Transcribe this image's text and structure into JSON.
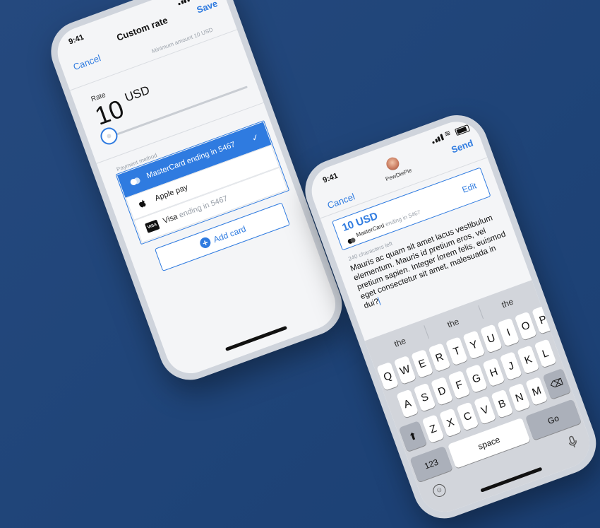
{
  "phone1": {
    "status": {
      "time": "9:41"
    },
    "nav": {
      "cancel": "Cancel",
      "title": "Custom rate",
      "save": "Save"
    },
    "hint": "Minimum amount 10 USD",
    "rate_label": "Rate",
    "amount": "10",
    "currency": "USD",
    "payment_section_label": "Payment method",
    "payment_methods": [
      {
        "label": "MasterCard ending in 5467",
        "selected": true,
        "icon": "mastercard-icon"
      },
      {
        "label": "Apple pay",
        "selected": false,
        "icon": "apple-icon"
      },
      {
        "label": "Visa",
        "suffix": "ending in 5467",
        "selected": false,
        "icon": "visa-icon"
      }
    ],
    "add_card": "Add card"
  },
  "phone2": {
    "status": {
      "time": "9:41"
    },
    "nav": {
      "cancel": "Cancel",
      "title": "PewDiePie",
      "send": "Send"
    },
    "card": {
      "amount": "10 USD",
      "method": "MasterCard",
      "method_suffix": "ending in 5467",
      "edit": "Edit"
    },
    "chars_left": "240 characters left",
    "message": "Mauris ac quam sit amet lacus vestibulum elementum. Mauris id pretium eros, vel pretium sapien. Integer lorem felis, euismod eget consectetur sit amet, malesuada in dui?",
    "keyboard": {
      "suggestions": [
        "the",
        "the",
        "the"
      ],
      "row1": [
        "Q",
        "W",
        "E",
        "R",
        "T",
        "Y",
        "U",
        "I",
        "O",
        "P"
      ],
      "row2": [
        "A",
        "S",
        "D",
        "F",
        "G",
        "H",
        "J",
        "K",
        "L"
      ],
      "row3": [
        "Z",
        "X",
        "C",
        "V",
        "B",
        "N",
        "M"
      ],
      "num": "123",
      "space": "space",
      "go": "Go"
    }
  },
  "colors": {
    "accent": "#2f7be0",
    "background": "#1f4478"
  }
}
